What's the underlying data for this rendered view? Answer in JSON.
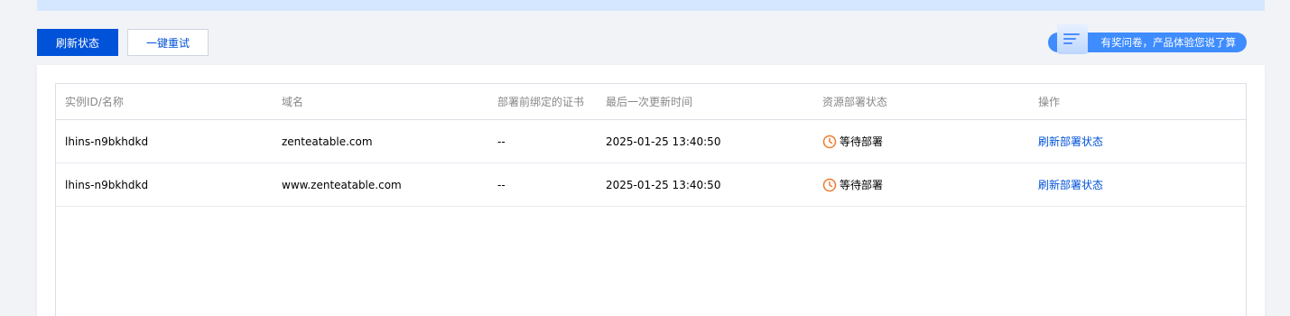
{
  "toolbar": {
    "refresh_status_label": "刷新状态",
    "retry_all_label": "一键重试"
  },
  "survey": {
    "label": "有奖问卷，产品体验您说了算"
  },
  "table": {
    "headers": [
      "实例ID/名称",
      "域名",
      "部署前绑定的证书",
      "最后一次更新时间",
      "资源部署状态",
      "操作"
    ],
    "rows": [
      {
        "instance_id": "lhins-n9bkhdkd",
        "domain": "zenteatable.com",
        "bound_cert": "--",
        "updated_at": "2025-01-25 13:40:50",
        "status": "等待部署",
        "status_icon": "clock-icon",
        "action": "刷新部署状态"
      },
      {
        "instance_id": "lhins-n9bkhdkd",
        "domain": "www.zenteatable.com",
        "bound_cert": "--",
        "updated_at": "2025-01-25 13:40:50",
        "status": "等待部署",
        "status_icon": "clock-icon",
        "action": "刷新部署状态"
      }
    ]
  },
  "colors": {
    "primary": "#0052d9",
    "pending": "#ed7b2f",
    "banner": "#d5e7ff"
  }
}
